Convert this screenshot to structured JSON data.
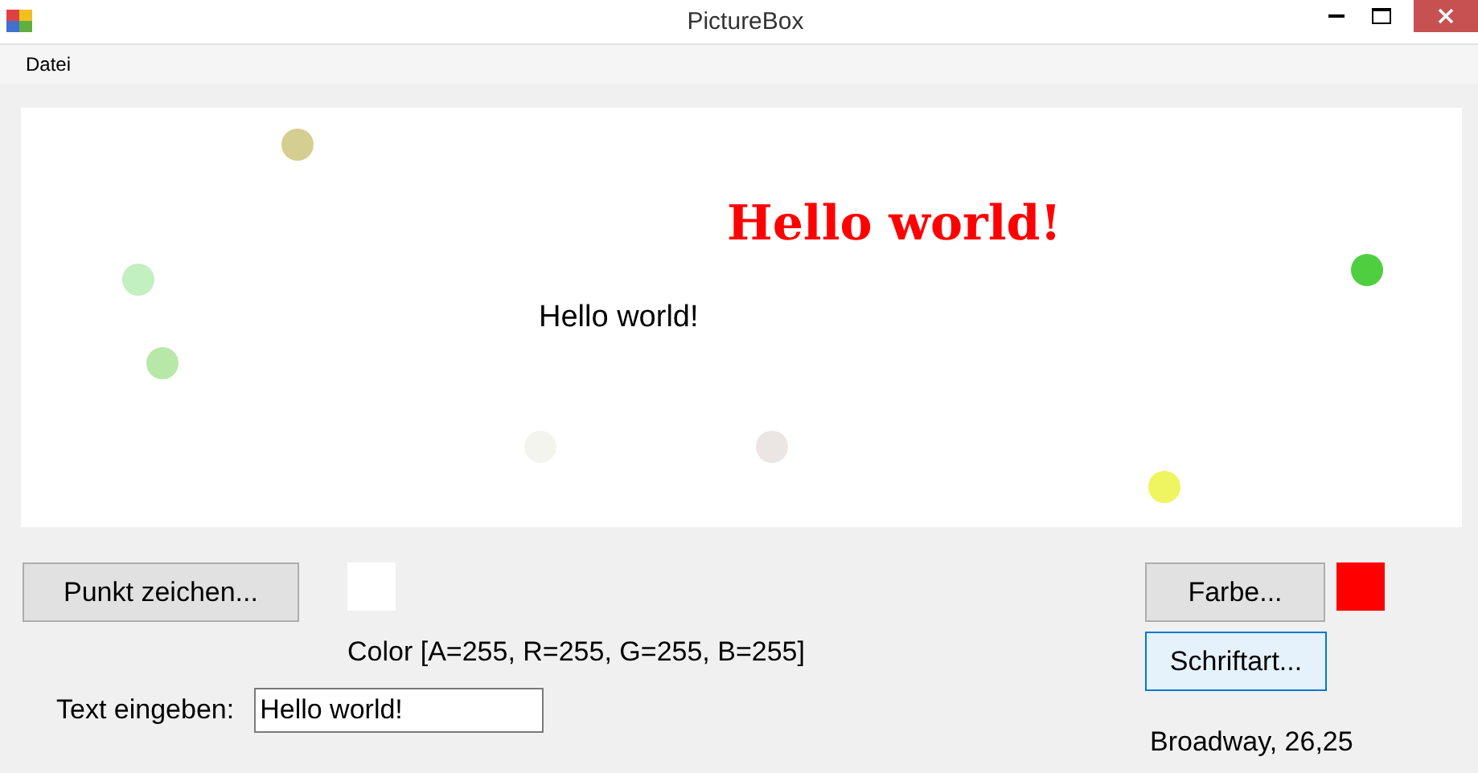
{
  "window": {
    "title": "PictureBox"
  },
  "menu": [
    {
      "label": "Datei"
    }
  ],
  "canvas": {
    "dots": [
      {
        "color": "#d4cf90"
      },
      {
        "color": "#c2f0c0"
      },
      {
        "color": "#b8e8a8"
      },
      {
        "color": "#f4f4ee"
      },
      {
        "color": "#ebe6e3"
      },
      {
        "color": "#eef560"
      },
      {
        "color": "#4fcf3f"
      }
    ],
    "texts": [
      {
        "kind": "styled",
        "text": "Hello world!",
        "color": "#ff0000"
      },
      {
        "kind": "plain",
        "text": "Hello world!"
      }
    ]
  },
  "controls": {
    "draw_point_button": "Punkt zeichen...",
    "point_swatch": {
      "color": "#ffffff"
    },
    "color_label": "Color [A=255, R=255, G=255, B=255]",
    "text_label": "Text eingeben:",
    "text_input": "Hello world!",
    "color_button": "Farbe...",
    "font_swatch": {
      "color": "#ff0000"
    },
    "font_button": "Schriftart...",
    "font_button_focused": true,
    "font_label": "Broadway, 26,25"
  }
}
